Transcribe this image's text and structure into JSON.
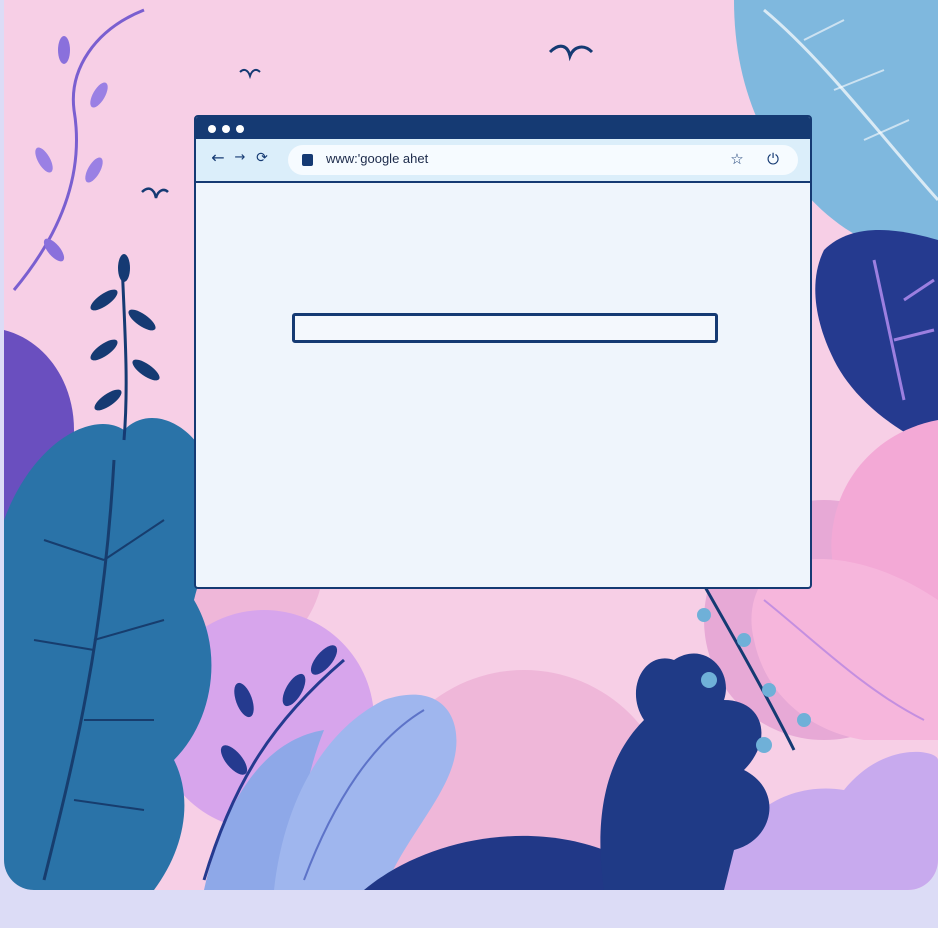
{
  "browser": {
    "url": "www:'google ahet",
    "nav": {
      "back_icon": "arrow-left-icon",
      "forward_icon": "arrow-right-icon",
      "reload_icon": "reload-icon"
    },
    "actions": {
      "bookmark_icon": "bookmark-icon",
      "extension_icon": "extension-icon"
    },
    "search": {
      "value": ""
    }
  },
  "colors": {
    "frame": "#153a73",
    "page_bg": "#eff5fc",
    "toolbar_bg": "#dbeefa",
    "scene_pink": "#f7cfe6",
    "outer_bg": "#dcdcf6"
  }
}
